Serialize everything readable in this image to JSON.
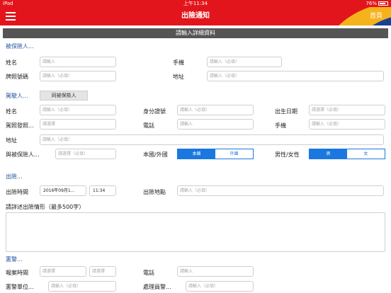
{
  "statusbar": {
    "carrier": "iPad",
    "time": "上午11:34",
    "battery": "76%"
  },
  "nav": {
    "title": "出險通知",
    "home": "首頁"
  },
  "form_header": "請輸入詳細資料",
  "insured": {
    "section_title": "被保險人...",
    "name_label": "姓名",
    "name_placeholder": "請輸入",
    "mobile_label": "手機",
    "mobile_placeholder": "請輸入（必填）",
    "plate_label": "牌照號碼",
    "plate_placeholder": "請輸入（必填）",
    "address_label": "地址",
    "address_placeholder": "請輸入（必填）"
  },
  "driver": {
    "section_title": "駕駛人...",
    "same_button": "同被保險人",
    "name_label": "姓名",
    "name_placeholder": "請輸入（必填）",
    "id_label": "身分證號",
    "id_placeholder": "請輸入（必填）",
    "birth_label": "出生日期",
    "birth_placeholder": "請選擇（必填）",
    "license_label": "駕照發照...",
    "license_placeholder": "請選擇",
    "phone_label": "電話",
    "phone_placeholder": "請輸入",
    "mobile_label": "手機",
    "mobile_placeholder": "請輸入（必填）",
    "address_label": "地址",
    "address_placeholder": "請輸入（必填）",
    "relation_label": "與被保險人...",
    "relation_placeholder": "請選擇（必填）",
    "nationality_label": "本國/外國",
    "nationality_options": [
      "本國",
      "外國"
    ],
    "gender_label": "男性/女性",
    "gender_options": [
      "男",
      "女"
    ]
  },
  "accident": {
    "section_title": "出險...",
    "time_label": "出險時間",
    "date_value": "2016年09月1...",
    "time_value": "11:34",
    "place_label": "出險地點",
    "place_placeholder": "請輸入（必填）",
    "desc_label": "請詳述出險情形（最多500字）"
  },
  "police": {
    "section_title": "憲警...",
    "report_time_label": "報案時間",
    "report_date_placeholder": "請選擇",
    "report_time_placeholder": "請選擇",
    "phone_label": "電話",
    "phone_placeholder": "請輸入",
    "unit_label": "憲警單位...",
    "unit_placeholder": "請輸入（必填）",
    "officer_label": "處理員警...",
    "officer_placeholder": "請輸入（必填）"
  }
}
